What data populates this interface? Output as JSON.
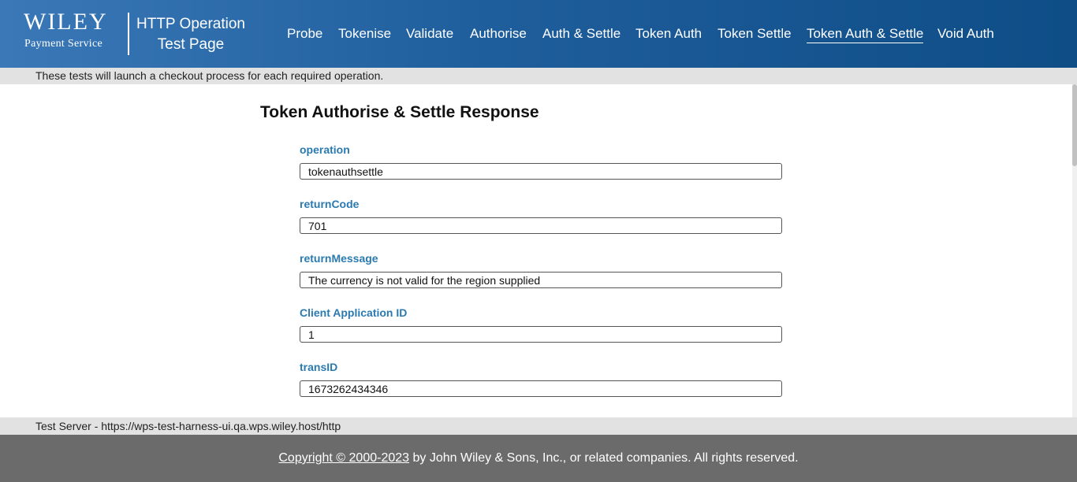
{
  "header": {
    "logo": {
      "brand": "WILEY",
      "subtitle": "Payment Service"
    },
    "app_title_line1": "HTTP Operation",
    "app_title_line2": "Test Page",
    "nav": [
      {
        "label": "Probe",
        "active": false
      },
      {
        "label": "Tokenise",
        "active": false
      },
      {
        "label": "Validate",
        "active": false
      },
      {
        "label": "Authorise",
        "active": false
      },
      {
        "label": "Auth & Settle",
        "active": false
      },
      {
        "label": "Token Auth",
        "active": false
      },
      {
        "label": "Token Settle",
        "active": false
      },
      {
        "label": "Token Auth & Settle",
        "active": true
      },
      {
        "label": "Void Auth",
        "active": false
      }
    ]
  },
  "notice": "These tests will launch a checkout process for each required operation.",
  "main": {
    "title": "Token Authorise & Settle Response",
    "fields": [
      {
        "label": "operation",
        "value": "tokenauthsettle"
      },
      {
        "label": "returnCode",
        "value": "701"
      },
      {
        "label": "returnMessage",
        "value": "The currency is not valid for the region supplied"
      },
      {
        "label": "Client Application ID",
        "value": "1"
      },
      {
        "label": "transID",
        "value": "1673262434346"
      }
    ]
  },
  "server": "Test Server - https://wps-test-harness-ui.qa.wps.wiley.host/http",
  "footer": {
    "copyright_link": "Copyright © 2000-2023",
    "copyright_rest": " by John Wiley & Sons, Inc., or related companies. All rights reserved."
  },
  "colors": {
    "header_start": "#3a78b8",
    "header_end": "#0e4d86",
    "label_blue": "#2a7ab0",
    "bar_gray": "#e2e2e2",
    "footer_gray": "#6b6b6b"
  }
}
